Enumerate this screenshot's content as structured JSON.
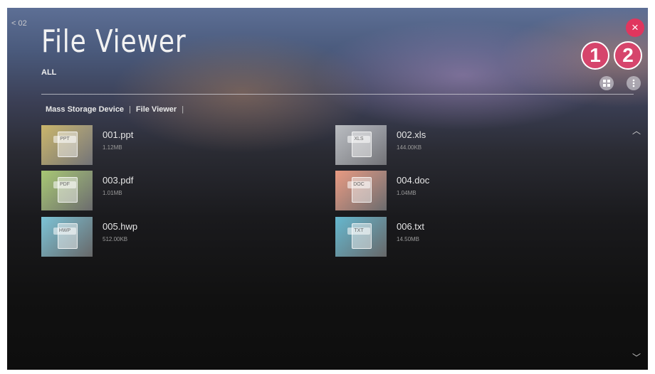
{
  "header": {
    "back_label": "< 02",
    "title": "File Viewer",
    "filter": "ALL",
    "close_label": "×"
  },
  "callouts": [
    "1",
    "2"
  ],
  "breadcrumb": [
    "Mass Storage Device",
    "File Viewer"
  ],
  "files": [
    {
      "name": "001.ppt",
      "size": "1.12MB",
      "tag": "PPT",
      "color": "#c9b56a"
    },
    {
      "name": "002.xls",
      "size": "144.00KB",
      "tag": "XLS",
      "color": "#b9bcc0"
    },
    {
      "name": "003.pdf",
      "size": "1.01MB",
      "tag": "PDF",
      "color": "#a7c773"
    },
    {
      "name": "004.doc",
      "size": "1.04MB",
      "tag": "DOC",
      "color": "#e89a82"
    },
    {
      "name": "005.hwp",
      "size": "512.00KB",
      "tag": "HWP",
      "color": "#7cc3d6"
    },
    {
      "name": "006.txt",
      "size": "14.50MB",
      "tag": "TXT",
      "color": "#66b8cf"
    }
  ],
  "icons": {
    "close": "close-icon",
    "view_toggle": "grid-view-icon",
    "options": "more-options-icon",
    "scroll_up": "chevron-up-icon",
    "scroll_down": "chevron-down-icon"
  },
  "colors": {
    "accent": "#e0365e",
    "callout": "#d6456c"
  }
}
